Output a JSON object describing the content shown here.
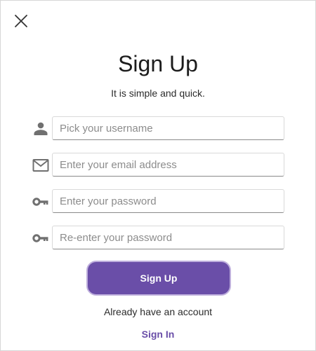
{
  "dialog": {
    "title": "Sign Up",
    "subtitle": "It is simple and quick."
  },
  "fields": [
    {
      "icon": "person-icon",
      "placeholder": "Pick your username",
      "value": ""
    },
    {
      "icon": "mail-icon",
      "placeholder": "Enter your email address",
      "value": ""
    },
    {
      "icon": "key-icon",
      "placeholder": "Enter your password",
      "value": ""
    },
    {
      "icon": "key-icon",
      "placeholder": "Re-enter your password",
      "value": ""
    }
  ],
  "actions": {
    "signup_label": "Sign Up",
    "already_text": "Already have an account",
    "signin_label": "Sign In"
  },
  "colors": {
    "accent": "#6a4ea8",
    "accent_border": "#bfb0dd",
    "icon": "#707070"
  }
}
